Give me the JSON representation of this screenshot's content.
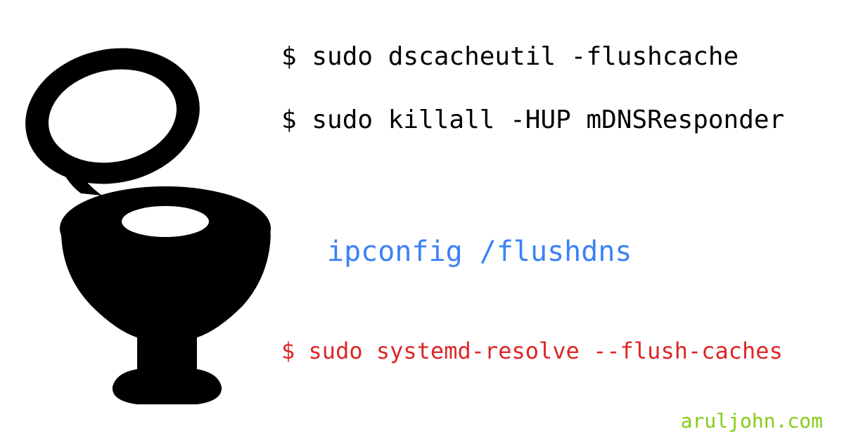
{
  "commands": {
    "macos_flush": "$ sudo dscacheutil -flushcache",
    "macos_killall": "$ sudo killall -HUP mDNSResponder",
    "windows_flush": "ipconfig /flushdns",
    "linux_flush": "$ sudo systemd-resolve --flush-caches"
  },
  "attribution": "aruljohn.com",
  "colors": {
    "black": "#000000",
    "blue": "#3b82f6",
    "red": "#dc2626",
    "green": "#84cc16"
  }
}
